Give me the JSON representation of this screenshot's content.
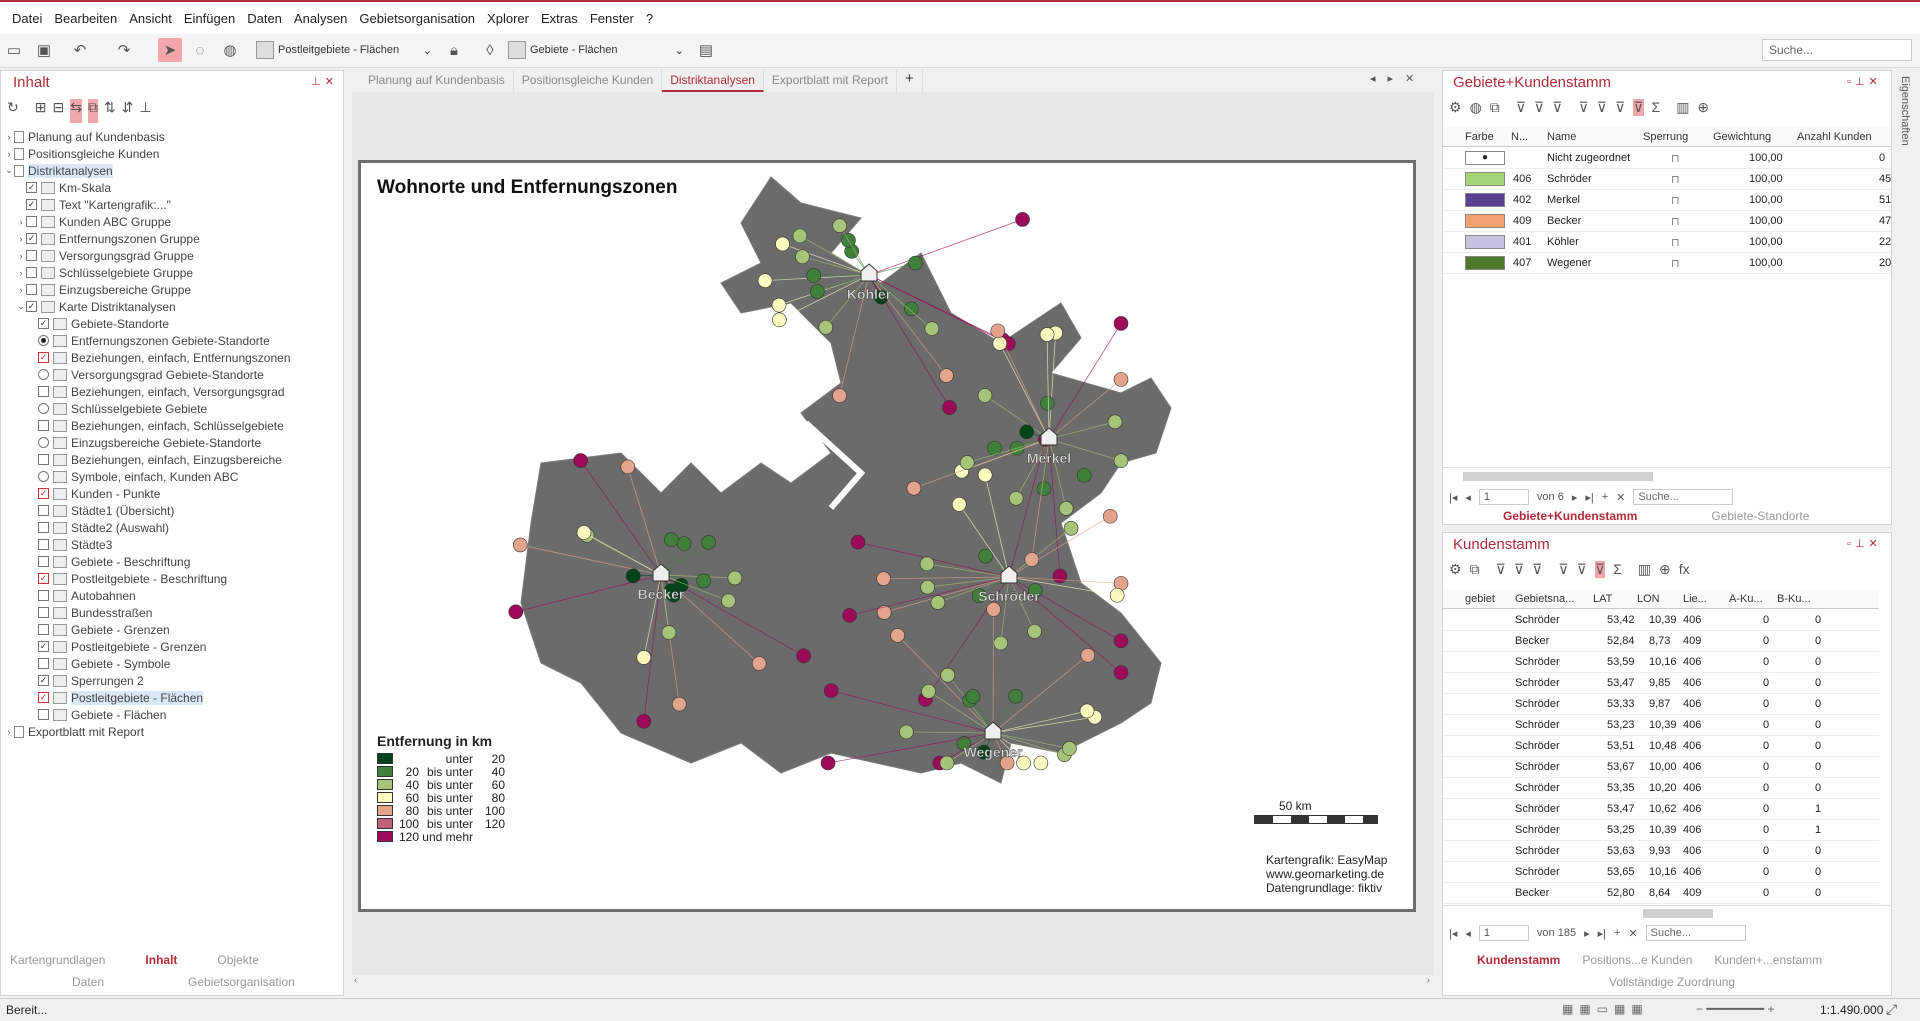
{
  "menu": [
    "Datei",
    "Bearbeiten",
    "Ansicht",
    "Einfügen",
    "Daten",
    "Analysen",
    "Gebietsorganisation",
    "Xplorer",
    "Extras",
    "Fenster",
    "?"
  ],
  "toolbar": {
    "layer_combo": "Postleitgebiete - Flächen",
    "area_combo": "Gebiete - Flächen",
    "search_placeholder": "Suche..."
  },
  "left_panel": {
    "title": "Inhalt",
    "tree": [
      {
        "label": "Planung auf Kundenbasis",
        "level": 0,
        "exp": "›",
        "kind": "doc"
      },
      {
        "label": "Positionsgleiche Kunden",
        "level": 0,
        "exp": "›",
        "kind": "doc"
      },
      {
        "label": "Distriktanalysen",
        "level": 0,
        "exp": "⌄",
        "kind": "doc",
        "sel": true
      },
      {
        "label": "Km-Skala",
        "level": 1,
        "kind": "cb-on"
      },
      {
        "label": "Text \"Kartengrafik:...\"",
        "level": 1,
        "kind": "cb-on"
      },
      {
        "label": "Kunden ABC Gruppe",
        "level": 1,
        "exp": "›",
        "kind": "cb"
      },
      {
        "label": "Entfernungszonen Gruppe",
        "level": 1,
        "exp": "›",
        "kind": "cb-on"
      },
      {
        "label": "Versorgungsgrad Gruppe",
        "level": 1,
        "exp": "›",
        "kind": "cb"
      },
      {
        "label": "Schlüsselgebiete Gruppe",
        "level": 1,
        "exp": "›",
        "kind": "cb"
      },
      {
        "label": "Einzugsbereiche Gruppe",
        "level": 1,
        "exp": "›",
        "kind": "cb"
      },
      {
        "label": "Karte Distriktanalysen",
        "level": 1,
        "exp": "⌄",
        "kind": "cb-on"
      },
      {
        "label": "Gebiete-Standorte",
        "level": 2,
        "kind": "cb-on"
      },
      {
        "label": "Entfernungszonen Gebiete-Standorte",
        "level": 2,
        "kind": "rb-on"
      },
      {
        "label": "Beziehungen, einfach, Entfernungszonen",
        "level": 2,
        "kind": "cb-red"
      },
      {
        "label": "Versorgungsgrad Gebiete-Standorte",
        "level": 2,
        "kind": "rb"
      },
      {
        "label": "Beziehungen, einfach, Versorgungsgrad",
        "level": 2,
        "kind": "cb"
      },
      {
        "label": "Schlüsselgebiete Gebiete",
        "level": 2,
        "kind": "rb"
      },
      {
        "label": "Beziehungen, einfach, Schlüsselgebiete",
        "level": 2,
        "kind": "cb"
      },
      {
        "label": "Einzugsbereiche Gebiete-Standorte",
        "level": 2,
        "kind": "rb"
      },
      {
        "label": "Beziehungen, einfach, Einzugsbereiche",
        "level": 2,
        "kind": "cb"
      },
      {
        "label": "Symbole, einfach, Kunden ABC",
        "level": 2,
        "kind": "rb"
      },
      {
        "label": "Kunden - Punkte",
        "level": 2,
        "kind": "cb-red"
      },
      {
        "label": "Städte1 (Übersicht)",
        "level": 2,
        "kind": "cb"
      },
      {
        "label": "Städte2 (Auswahl)",
        "level": 2,
        "kind": "cb"
      },
      {
        "label": "Städte3",
        "level": 2,
        "kind": "cb"
      },
      {
        "label": "Gebiete - Beschriftung",
        "level": 2,
        "kind": "cb"
      },
      {
        "label": "Postleitgebiete - Beschriftung",
        "level": 2,
        "kind": "cb-red"
      },
      {
        "label": "Autobahnen",
        "level": 2,
        "kind": "cb"
      },
      {
        "label": "Bundesstraßen",
        "level": 2,
        "kind": "cb"
      },
      {
        "label": "Gebiete - Grenzen",
        "level": 2,
        "kind": "cb"
      },
      {
        "label": "Postleitgebiete - Grenzen",
        "level": 2,
        "kind": "cb-on"
      },
      {
        "label": "Gebiete - Symbole",
        "level": 2,
        "kind": "cb"
      },
      {
        "label": "Sperrungen 2",
        "level": 2,
        "kind": "cb-on"
      },
      {
        "label": "Postleitgebiete - Flächen",
        "level": 2,
        "kind": "cb-red",
        "sel": true
      },
      {
        "label": "Gebiete - Flächen",
        "level": 2,
        "kind": "cb"
      },
      {
        "label": "Exportblatt mit Report",
        "level": 0,
        "exp": "›",
        "kind": "doc"
      }
    ],
    "bottom_tabs": [
      "Kartengrundlagen",
      "Inhalt",
      "Objekte"
    ],
    "bottom_tabs2": [
      "Daten",
      "Gebietsorganisation"
    ]
  },
  "tabs": [
    "Planung auf Kundenbasis",
    "Positionsgleiche Kunden",
    "Distriktanalysen",
    "Exportblatt mit Report"
  ],
  "map": {
    "title": "Wohnorte und Entfernungszonen",
    "legend_title": "Entfernung in km",
    "legend": [
      {
        "color": "#00441b",
        "a": "",
        "b": "unter",
        "c": "20"
      },
      {
        "color": "#41803a",
        "a": "20",
        "b": "bis unter",
        "c": "40"
      },
      {
        "color": "#a6c378",
        "a": "40",
        "b": "bis unter",
        "c": "60"
      },
      {
        "color": "#fdfac0",
        "a": "60",
        "b": "bis unter",
        "c": "80"
      },
      {
        "color": "#e4a48c",
        "a": "80",
        "b": "bis unter",
        "c": "100"
      },
      {
        "color": "#c1607a",
        "a": "100",
        "b": "bis unter",
        "c": "120"
      },
      {
        "color": "#9c0a5a",
        "a": "120",
        "b": "und mehr",
        "c": ""
      }
    ],
    "scale": "50 km",
    "credits": [
      "Kartengrafik: EasyMap",
      "www.geomarketing.de",
      "Datengrundlage: fiktiv"
    ],
    "sites": [
      "Köhler",
      "Merkel",
      "Becker",
      "Schröder",
      "Wegener"
    ]
  },
  "right_top": {
    "title": "Gebiete+Kundenstamm",
    "columns": [
      "Farbe",
      "N...",
      "Name",
      "Sperrung",
      "Gewichtung",
      "Anzahl Kunden"
    ],
    "rows": [
      {
        "color": "#ffffff",
        "dot": true,
        "n": "",
        "name": "Nicht zugeordnet",
        "w": "100,00",
        "k": "0"
      },
      {
        "color": "#a3d47a",
        "n": "406",
        "name": "Schröder",
        "w": "100,00",
        "k": "45"
      },
      {
        "color": "#5a3f8f",
        "n": "402",
        "name": "Merkel",
        "w": "100,00",
        "k": "51"
      },
      {
        "color": "#f4a070",
        "n": "409",
        "name": "Becker",
        "w": "100,00",
        "k": "47"
      },
      {
        "color": "#c7c2e0",
        "n": "401",
        "name": "Köhler",
        "w": "100,00",
        "k": "22"
      },
      {
        "color": "#4e7a2c",
        "n": "407",
        "name": "Wegener",
        "w": "100,00",
        "k": "20"
      }
    ],
    "nav_page": "1",
    "nav_of": "von 6",
    "search": "Suche...",
    "tabs": [
      "Gebiete+Kundenstamm",
      "Gebiete-Standorte"
    ]
  },
  "right_bottom": {
    "title": "Kundenstamm",
    "columns": [
      "gebiet",
      "Gebietsna...",
      "LAT",
      "LON",
      "Lie...",
      "A-Ku...",
      "B-Ku..."
    ],
    "rows": [
      [
        "Schröder",
        "53,42",
        "10,39",
        "406",
        "0",
        "0"
      ],
      [
        "Becker",
        "52,84",
        "8,73",
        "409",
        "0",
        "0"
      ],
      [
        "Schröder",
        "53,59",
        "10,16",
        "406",
        "0",
        "0"
      ],
      [
        "Schröder",
        "53,47",
        "9,85",
        "406",
        "0",
        "0"
      ],
      [
        "Schröder",
        "53,33",
        "9,87",
        "406",
        "0",
        "0"
      ],
      [
        "Schröder",
        "53,23",
        "10,39",
        "406",
        "0",
        "0"
      ],
      [
        "Schröder",
        "53,51",
        "10,48",
        "406",
        "0",
        "0"
      ],
      [
        "Schröder",
        "53,67",
        "10,00",
        "406",
        "0",
        "0"
      ],
      [
        "Schröder",
        "53,35",
        "10,20",
        "406",
        "0",
        "0"
      ],
      [
        "Schröder",
        "53,47",
        "10,62",
        "406",
        "0",
        "1"
      ],
      [
        "Schröder",
        "53,25",
        "10,39",
        "406",
        "0",
        "1"
      ],
      [
        "Schröder",
        "53,63",
        "9,93",
        "406",
        "0",
        "0"
      ],
      [
        "Schröder",
        "53,65",
        "10,16",
        "406",
        "0",
        "0"
      ],
      [
        "Becker",
        "52,80",
        "8,64",
        "409",
        "0",
        "0"
      ]
    ],
    "nav_page": "1",
    "nav_of": "von 185",
    "search": "Suche...",
    "tabs": [
      "Kundenstamm",
      "Positions...e Kunden",
      "Kunden+...enstamm"
    ],
    "tabs2": "Vollständige Zuordnung"
  },
  "side_label": "Eigenschaften",
  "status": {
    "text": "Bereit...",
    "scale": "1:1.490.000"
  }
}
